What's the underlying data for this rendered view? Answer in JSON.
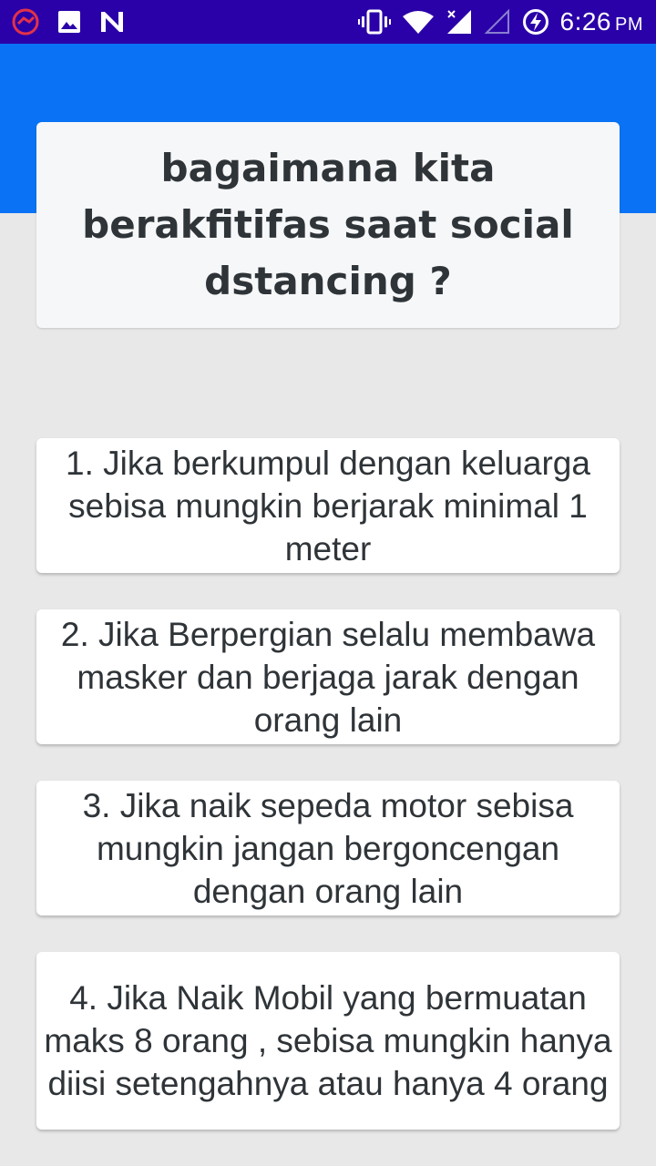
{
  "status_bar": {
    "time": "6:26",
    "ampm": "PM",
    "icons": [
      "app-notification-icon",
      "image-icon",
      "n-icon",
      "vibrate-icon",
      "wifi-icon",
      "signal-icon",
      "signal-empty-icon",
      "battery-charging-icon"
    ]
  },
  "colors": {
    "status_bar": "#2a00a8",
    "app_bar": "#0a73f5",
    "background": "#e8e8e8",
    "text": "#2f3438"
  },
  "header": {
    "title": "bagaimana kita berakfitifas saat social dstancing ?"
  },
  "tips": [
    {
      "text": "1. Jika berkumpul dengan keluarga sebisa mungkin berjarak minimal 1 meter"
    },
    {
      "text": "2. Jika Berpergian selalu membawa masker dan berjaga jarak dengan orang lain"
    },
    {
      "text": "3. Jika naik sepeda motor sebisa mungkin jangan bergoncengan dengan orang lain"
    },
    {
      "text": "4. Jika Naik Mobil yang bermuatan maks 8 orang , sebisa mungkin hanya diisi setengahnya atau hanya 4 orang"
    }
  ]
}
